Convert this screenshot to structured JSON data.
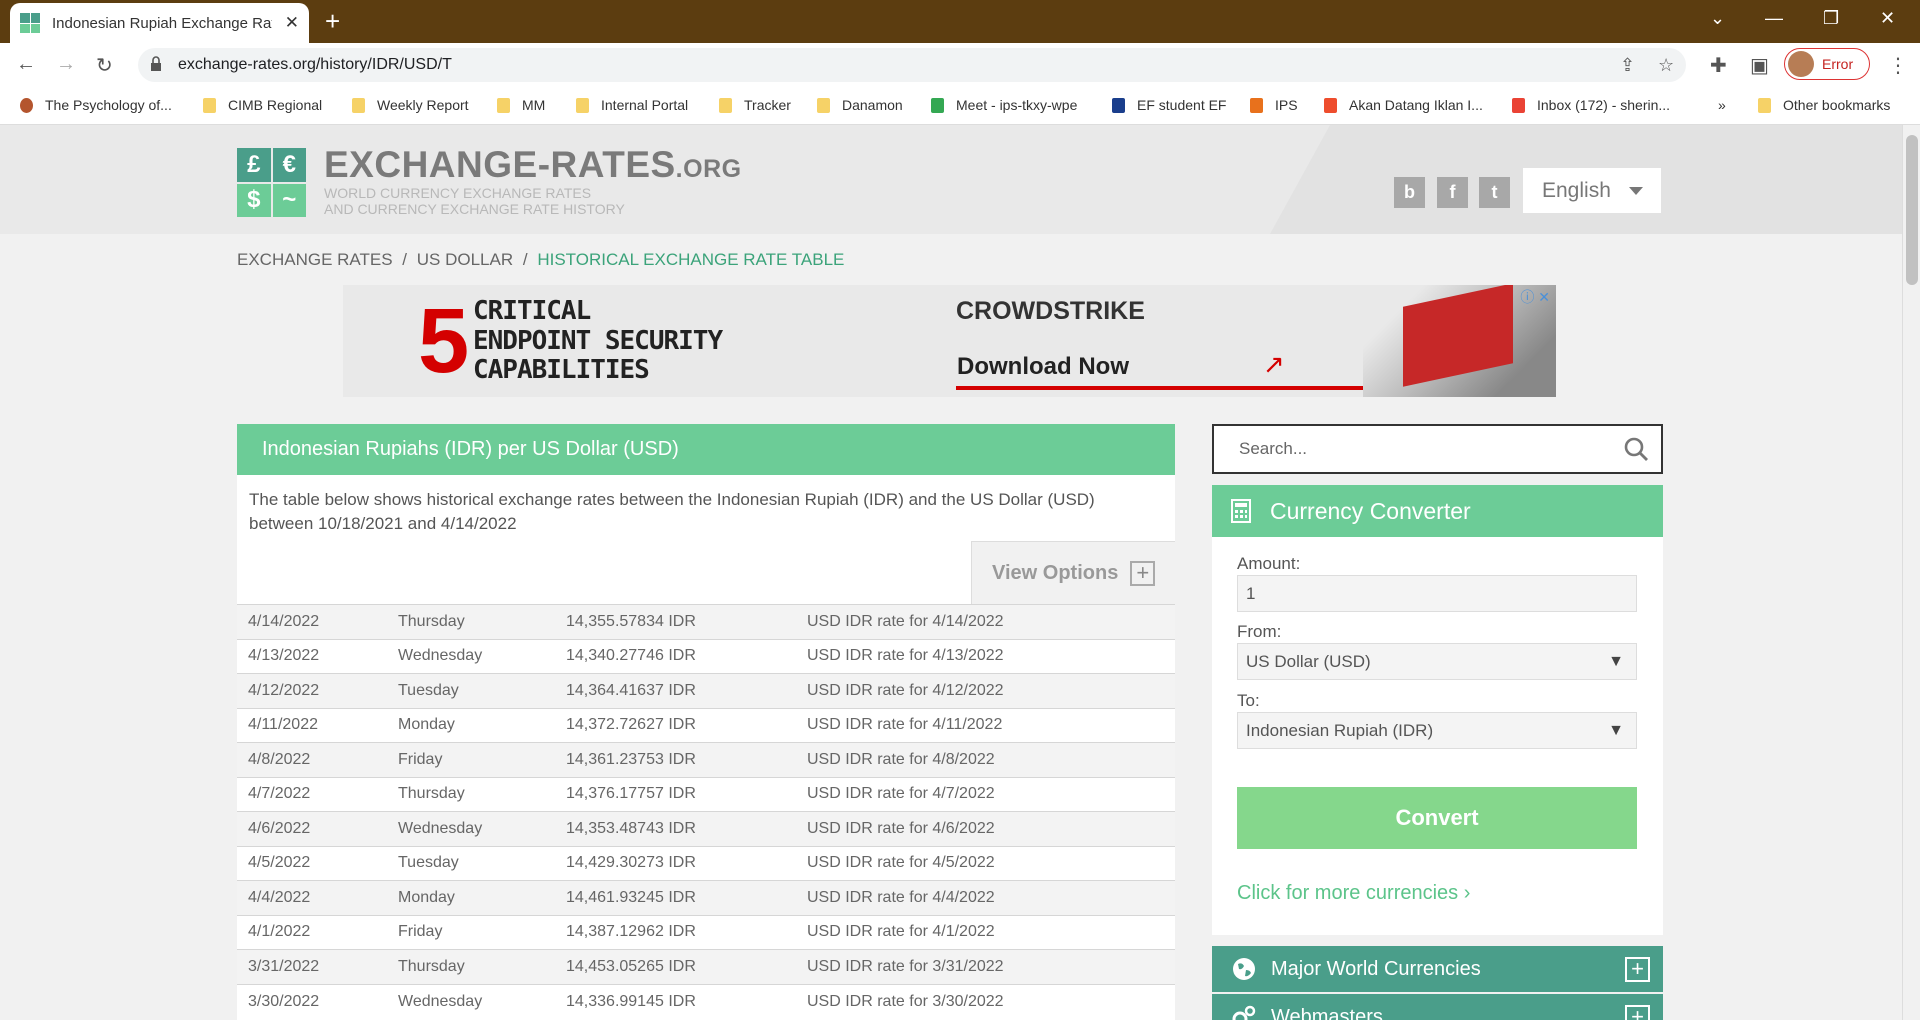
{
  "browser": {
    "tab_title": "Indonesian Rupiah Exchange Rat",
    "url": "exchange-rates.org/history/IDR/USD/T",
    "profile_status": "Error",
    "bookmarks": [
      "The Psychology of...",
      "CIMB Regional",
      "Weekly Report",
      "MM",
      "Internal Portal",
      "Tracker",
      "Danamon",
      "Meet - ips-tkxy-wpe",
      "EF student EF",
      "IPS",
      "Akan Datang Iklan I...",
      "Inbox (172) - sherin...",
      "Other bookmarks"
    ],
    "overflow": "»"
  },
  "site": {
    "logo_glyphs": [
      "£",
      "€",
      "$",
      "~"
    ],
    "name": "EXCHANGE-RATES",
    "name_suffix": ".ORG",
    "tagline_1": "WORLD CURRENCY EXCHANGE RATES",
    "tagline_2": "AND CURRENCY EXCHANGE RATE HISTORY",
    "social": [
      "b",
      "f",
      "t"
    ],
    "language": "English"
  },
  "breadcrumb": {
    "items": [
      "EXCHANGE RATES",
      "US DOLLAR"
    ],
    "current": "HISTORICAL EXCHANGE RATE TABLE",
    "separator": "/"
  },
  "ad": {
    "number": "5",
    "line1": "CRITICAL",
    "line2": "ENDPOINT SECURITY",
    "line3": "CAPABILITIES",
    "brand": "CROWDSTRIKE",
    "cta": "Download Now"
  },
  "main": {
    "heading": "Indonesian Rupiahs (IDR) per US Dollar (USD)",
    "description": "The table below shows historical exchange rates between the Indonesian Rupiah (IDR) and the US Dollar (USD) between 10/18/2021 and 4/14/2022",
    "view_options": "View Options",
    "rows": [
      {
        "date": "4/14/2022",
        "day": "Thursday",
        "rate": "14,355.57834 IDR",
        "link": "USD IDR rate for 4/14/2022"
      },
      {
        "date": "4/13/2022",
        "day": "Wednesday",
        "rate": "14,340.27746 IDR",
        "link": "USD IDR rate for 4/13/2022"
      },
      {
        "date": "4/12/2022",
        "day": "Tuesday",
        "rate": "14,364.41637 IDR",
        "link": "USD IDR rate for 4/12/2022"
      },
      {
        "date": "4/11/2022",
        "day": "Monday",
        "rate": "14,372.72627 IDR",
        "link": "USD IDR rate for 4/11/2022"
      },
      {
        "date": "4/8/2022",
        "day": "Friday",
        "rate": "14,361.23753 IDR",
        "link": "USD IDR rate for 4/8/2022"
      },
      {
        "date": "4/7/2022",
        "day": "Thursday",
        "rate": "14,376.17757 IDR",
        "link": "USD IDR rate for 4/7/2022"
      },
      {
        "date": "4/6/2022",
        "day": "Wednesday",
        "rate": "14,353.48743 IDR",
        "link": "USD IDR rate for 4/6/2022"
      },
      {
        "date": "4/5/2022",
        "day": "Tuesday",
        "rate": "14,429.30273 IDR",
        "link": "USD IDR rate for 4/5/2022"
      },
      {
        "date": "4/4/2022",
        "day": "Monday",
        "rate": "14,461.93245 IDR",
        "link": "USD IDR rate for 4/4/2022"
      },
      {
        "date": "4/1/2022",
        "day": "Friday",
        "rate": "14,387.12962 IDR",
        "link": "USD IDR rate for 4/1/2022"
      },
      {
        "date": "3/31/2022",
        "day": "Thursday",
        "rate": "14,453.05265 IDR",
        "link": "USD IDR rate for 3/31/2022"
      },
      {
        "date": "3/30/2022",
        "day": "Wednesday",
        "rate": "14,336.99145 IDR",
        "link": "USD IDR rate for 3/30/2022"
      }
    ]
  },
  "sidebar": {
    "search_placeholder": "Search...",
    "converter": {
      "title": "Currency Converter",
      "amount_label": "Amount:",
      "amount_value": "1",
      "from_label": "From:",
      "from_value": "US Dollar (USD)",
      "to_label": "To:",
      "to_value": "Indonesian Rupiah (IDR)",
      "convert_label": "Convert",
      "more_link": "Click for more currencies ›"
    },
    "sections": [
      "Major World Currencies",
      "Webmasters"
    ]
  },
  "colors": {
    "accent_green": "#6ccc97",
    "convert_green": "#85d78c",
    "section_teal": "#4a9e8a",
    "browser_frame": "#5c3d10"
  }
}
